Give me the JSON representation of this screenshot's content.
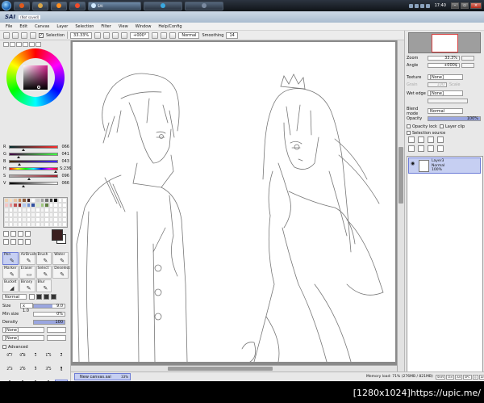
{
  "taskbar": {
    "active_window_label": "SAI",
    "clock": "17:40"
  },
  "titlebar": {
    "app_name": "SAI",
    "doc_name": "(Not saved)"
  },
  "menu": {
    "items": [
      "File",
      "Edit",
      "Canvas",
      "Layer",
      "Selection",
      "Filter",
      "View",
      "Window",
      "Help/Config"
    ]
  },
  "toolbar": {
    "selection_label": "Selection",
    "zoom": "33.33%",
    "rotation": "+000°",
    "blend_mode": "Normal",
    "smoothing_label": "Smoothing",
    "smoothing_value": "14"
  },
  "color_sliders": [
    {
      "label": "R",
      "value": "066",
      "pos": 0.26
    },
    {
      "label": "G",
      "value": "041",
      "pos": 0.16
    },
    {
      "label": "B",
      "value": "043",
      "pos": 0.17
    },
    {
      "label": "H",
      "value": "S:236",
      "pos": 0.95
    },
    {
      "label": "S",
      "value": "096",
      "pos": 0.38
    },
    {
      "label": "V",
      "value": "066",
      "pos": 0.26
    }
  ],
  "tools": [
    {
      "name": "Pen",
      "glyph": "✎",
      "selected": true
    },
    {
      "name": "AirBrush",
      "glyph": "✎",
      "selected": false
    },
    {
      "name": "Brush",
      "glyph": "✎",
      "selected": false
    },
    {
      "name": "Water",
      "glyph": "✎",
      "selected": false
    },
    {
      "name": "Marker",
      "glyph": "✎",
      "selected": false
    },
    {
      "name": "Eraser",
      "glyph": "▭",
      "selected": false
    },
    {
      "name": "Select",
      "glyph": "✎",
      "selected": false
    },
    {
      "name": "Deselect",
      "glyph": "✎",
      "selected": false
    },
    {
      "name": "Bucket",
      "glyph": "◢",
      "selected": false
    },
    {
      "name": "Binary",
      "glyph": "✎",
      "selected": false
    },
    {
      "name": "Blur",
      "glyph": "✎",
      "selected": false
    }
  ],
  "brush_settings": {
    "mode": "Normal",
    "size_label": "Size",
    "size_mult": "x 1.0",
    "size_value": "9.0",
    "min_size_label": "Min size",
    "min_size_value": "0%",
    "density_label": "Density",
    "density_value": "100",
    "shape": "[None]",
    "texture": "[None]",
    "advanced_label": "Advanced"
  },
  "brush_sizes": [
    {
      "label": "0.7",
      "dot": 1
    },
    {
      "label": "0.8",
      "dot": 1
    },
    {
      "label": "1",
      "dot": 1
    },
    {
      "label": "1.5",
      "dot": 1
    },
    {
      "label": "2",
      "dot": 1
    },
    {
      "label": "2.3",
      "dot": 1
    },
    {
      "label": "2.6",
      "dot": 1
    },
    {
      "label": "3",
      "dot": 1
    },
    {
      "label": "3.5",
      "dot": 1
    },
    {
      "label": "4",
      "dot": 2
    },
    {
      "label": "5",
      "dot": 2
    },
    {
      "label": "6",
      "dot": 2
    },
    {
      "label": "7",
      "dot": 2
    },
    {
      "label": "8",
      "dot": 2
    },
    {
      "label": "9",
      "dot": 3,
      "selected": true
    },
    {
      "label": "10",
      "dot": 3
    },
    {
      "label": "12",
      "dot": 3
    },
    {
      "label": "14",
      "dot": 3
    },
    {
      "label": "16",
      "dot": 4
    },
    {
      "label": "20",
      "dot": 4
    },
    {
      "label": "25",
      "dot": 5
    },
    {
      "label": "30",
      "dot": 5
    },
    {
      "label": "35",
      "dot": 5
    },
    {
      "label": "40",
      "dot": 5
    },
    {
      "label": "50",
      "dot": 6
    }
  ],
  "navigator": {
    "zoom_label": "Zoom",
    "zoom_value": "33.3%",
    "angle_label": "Angle",
    "angle_value": "+000$"
  },
  "layer_panel": {
    "texture_label": "Texture",
    "texture_value": "[None]",
    "grain_label": "Grain",
    "grain_value": "100",
    "scale_label": "Scale",
    "scale_value": "100%",
    "wet_edge_label": "Wet edge",
    "wet_edge_value": "[None]",
    "blend_mode_label": "Blend mode",
    "blend_mode_value": "Normal",
    "opacity_label": "Opacity",
    "opacity_value": "100%",
    "opacity_lock_label": "Opacity lock",
    "layer_clip_label": "Layer clip",
    "selection_source_label": "Selection source"
  },
  "layers": [
    {
      "name": "Layer3",
      "mode": "Normal",
      "opacity": "100%"
    }
  ],
  "status": {
    "doc_tab": "New canvas.sai",
    "doc_zoom": "33%",
    "memory": "Memory load: 71% (276MB / 821MB)",
    "keys": [
      "Shift",
      "Ctrl",
      "Alt",
      "SPC",
      "◎",
      "Any"
    ]
  },
  "watermark": "[1280x1024]https://upic.me/",
  "colors": {
    "accent": "#c6cff2",
    "accent_border": "#6c7bd6",
    "primary_color": "#3a1e1e"
  }
}
